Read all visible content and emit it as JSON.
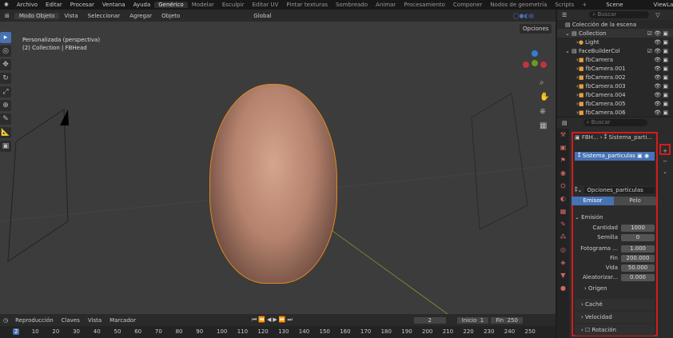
{
  "topbar": {
    "menus": [
      "Archivo",
      "Editar",
      "Procesar",
      "Ventana",
      "Ayuda"
    ],
    "workspaces": [
      "Genérico",
      "Modelar",
      "Esculpir",
      "Editar UV",
      "Pintar texturas",
      "Sombreado",
      "Animar",
      "Procesamiento",
      "Componer",
      "Nodos de geometría",
      "Scripts",
      "+"
    ],
    "scene": "Scene",
    "viewlayer": "ViewLayer"
  },
  "viewport_header": {
    "mode": "Modo Objeto",
    "menus": [
      "Vista",
      "Seleccionar",
      "Agregar",
      "Objeto"
    ],
    "orientation": "Global",
    "options": "Opciones"
  },
  "viewport": {
    "view_name": "Personalizada (perspectiva)",
    "collection": "(2) Collection | FBHead"
  },
  "outliner": {
    "search_placeholder": "Buscar",
    "root": "Colección de la escena",
    "items": [
      "Collection",
      "Light",
      "FaceBuilderCol",
      "fbCamera",
      "fbCamera.001",
      "fbCamera.002",
      "fbCamera.003",
      "fbCamera.004",
      "fbCamera.005",
      "fbCamera.006"
    ]
  },
  "properties": {
    "search_placeholder": "Buscar",
    "breadcrumb_obj": "FBH...",
    "breadcrumb_sys": "Sistema_parti...",
    "system_item": "Sistema_particulas",
    "settings_name": "Opciones_particulas",
    "tabs": [
      "Emisor",
      "Pelo"
    ],
    "emission": "Emisión",
    "fields": [
      {
        "label": "Cantidad",
        "value": "1000"
      },
      {
        "label": "Semilla",
        "value": "0"
      },
      {
        "label": "Fotograma ...",
        "value": "1.000"
      },
      {
        "label": "Fin",
        "value": "200.000"
      },
      {
        "label": "Vida",
        "value": "50.000"
      },
      {
        "label": "Aleatorizar...",
        "value": "0.000"
      }
    ],
    "origin": "Origen",
    "panels": [
      "Caché",
      "Velocidad",
      "Rotación"
    ]
  },
  "timeline": {
    "menus": [
      "Reproducción",
      "Claves",
      "Vista",
      "Marcador"
    ],
    "current": "2",
    "start_label": "Inicio",
    "start": "1",
    "end_label": "Fin",
    "end": "250",
    "ticks": [
      "2",
      "10",
      "20",
      "30",
      "40",
      "50",
      "60",
      "70",
      "80",
      "90",
      "100",
      "110",
      "120",
      "130",
      "140",
      "150",
      "160",
      "170",
      "180",
      "190",
      "200",
      "210",
      "220",
      "230",
      "240",
      "250"
    ]
  },
  "colors": {
    "accent": "#4772b3",
    "selection": "#e08a20",
    "highlight": "#d21c1c"
  }
}
